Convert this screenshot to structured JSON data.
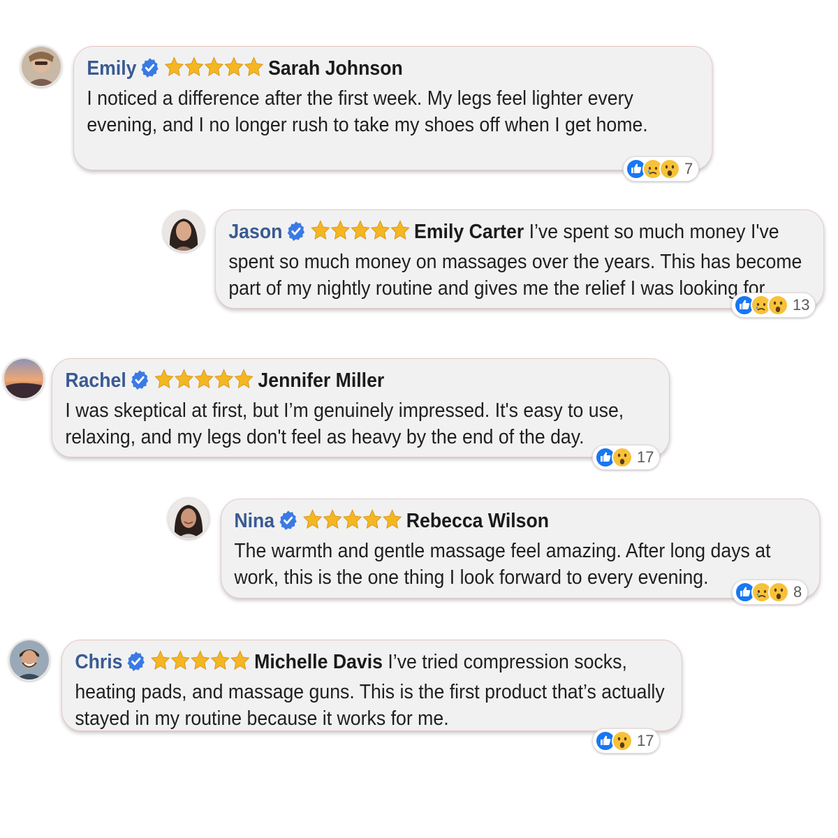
{
  "colors": {
    "name": "#3a5a92",
    "verified": "#3b7ae4",
    "star": "#f5b623",
    "like": "#1877f2",
    "bubble_bg": "#f1f1f1"
  },
  "reviews": [
    {
      "name": "Emily",
      "reviewer": "Sarah Johnson",
      "rating": 5,
      "text": "I noticed a difference after the first week. My legs feel lighter every evening, and I no longer rush to take my shoes off when I get home.",
      "reactions": [
        "like-icon",
        "sad-icon",
        "wow-icon"
      ],
      "count": "7"
    },
    {
      "name": "Jason",
      "reviewer": "Emily Carter",
      "rating": 5,
      "text": "I’ve spent so much money I've spent so much money on massages over the years. This has become part of my nightly routine and gives me the relief I was looking for.",
      "reactions": [
        "like-icon",
        "sad-icon",
        "wow-icon"
      ],
      "count": "13"
    },
    {
      "name": "Rachel",
      "reviewer": "Jennifer Miller",
      "rating": 5,
      "text": "I was skeptical at first, but I’m genuinely impressed. It's easy to use, relaxing, and my legs don't feel as heavy by the end of the day.",
      "reactions": [
        "like-icon",
        "wow-icon"
      ],
      "count": "17"
    },
    {
      "name": "Nina",
      "reviewer": "Rebecca Wilson",
      "rating": 5,
      "text": "The warmth and gentle massage feel amazing. After long days at work, this is the one thing I look forward to every evening.",
      "reactions": [
        "like-icon",
        "sad-icon",
        "wow-icon"
      ],
      "count": "8"
    },
    {
      "name": "Chris",
      "reviewer": "Michelle Davis",
      "rating": 5,
      "text": "I’ve tried compression socks, heating pads, and massage guns. This is the first product that’s actually stayed in my routine because it works for me.",
      "reactions": [
        "like-icon",
        "wow-icon"
      ],
      "count": "17"
    }
  ]
}
